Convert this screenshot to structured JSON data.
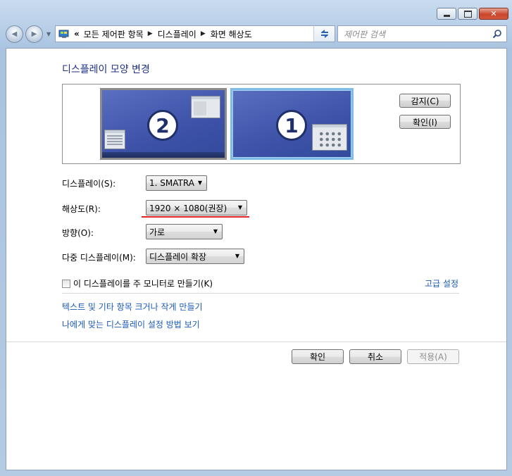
{
  "window": {
    "caption_buttons": [
      "minimize",
      "maximize",
      "close"
    ],
    "close_glyph": "✕"
  },
  "nav": {
    "back_glyph": "◀",
    "forward_glyph": "▶",
    "prefix": "«",
    "breadcrumbs": [
      "모든 제어판 항목",
      "디스플레이",
      "화면 해상도"
    ],
    "search_placeholder": "제어판 검색"
  },
  "main": {
    "title": "디스플레이 모양 변경",
    "monitors": [
      {
        "number": "2",
        "selected": false
      },
      {
        "number": "1",
        "selected": true
      }
    ],
    "detect_button": "감지(C)",
    "identify_button": "확인(I)",
    "fields": {
      "display": {
        "label": "디스플레이(S):",
        "value": "1. SMATRA"
      },
      "resolution": {
        "label": "해상도(R):",
        "value": "1920 × 1080(권장)"
      },
      "orientation": {
        "label": "방향(O):",
        "value": "가로"
      },
      "multiple": {
        "label": "다중 디스플레이(M):",
        "value": "디스플레이 확장"
      }
    },
    "make_main_checkbox": {
      "label": "이 디스플레이를 주 모니터로 만들기(K)",
      "checked": false
    },
    "advanced_link": "고급 설정",
    "links": [
      "텍스트 및 기타 항목 크거나 작게 만들기",
      "나에게 맞는 디스플레이 설정 방법 보기"
    ]
  },
  "footer": {
    "ok": "확인",
    "cancel": "취소",
    "apply": "적용(A)"
  },
  "colors": {
    "title": "#1e3287",
    "link": "#1a5ab8",
    "highlight_underline": "#e02424",
    "monitor_fill": "#3d52a8",
    "selected_border": "#7fbde6"
  }
}
